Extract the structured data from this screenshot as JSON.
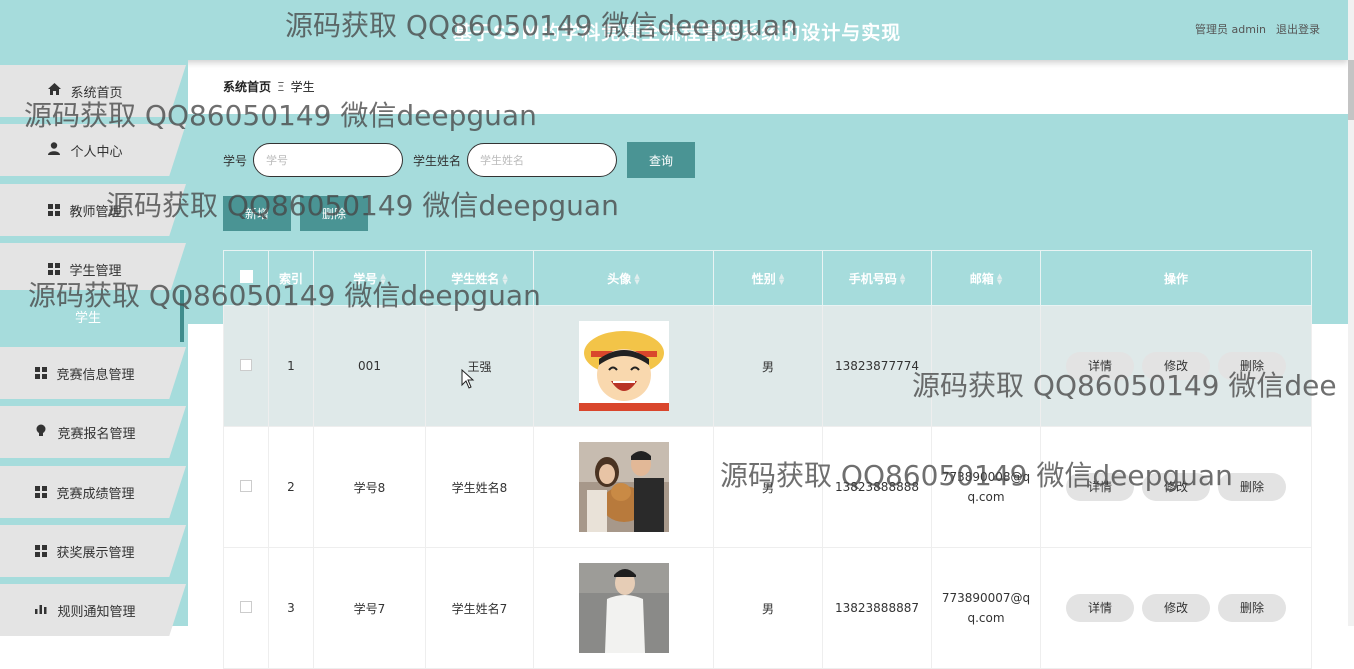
{
  "header": {
    "title": "基于SSM的学科竞赛全流程管理系统的设计与实现",
    "user": "管理员 admin",
    "logout": "退出登录"
  },
  "sidebar": {
    "items": [
      {
        "label": "系统首页",
        "icon": "home-icon"
      },
      {
        "label": "个人中心",
        "icon": "user-icon"
      },
      {
        "label": "教师管理",
        "icon": "grid-icon"
      },
      {
        "label": "学生管理",
        "icon": "grid-icon"
      },
      {
        "label": "学生",
        "icon": ""
      },
      {
        "label": "竞赛信息管理",
        "icon": "grid-icon"
      },
      {
        "label": "竞赛报名管理",
        "icon": "bulb-icon"
      },
      {
        "label": "竞赛成绩管理",
        "icon": "grid-icon"
      },
      {
        "label": "获奖展示管理",
        "icon": "grid-icon"
      },
      {
        "label": "规则通知管理",
        "icon": "bar-chart-icon"
      }
    ]
  },
  "breadcrumb": {
    "home": "系统首页",
    "sep": "Ξ",
    "current": "学生"
  },
  "search": {
    "label1": "学号",
    "placeholder1": "学号",
    "label2": "学生姓名",
    "placeholder2": "学生姓名",
    "button": "查询"
  },
  "actions": {
    "add": "新增",
    "delete": "删除"
  },
  "table": {
    "headers": [
      "索引",
      "学号",
      "学生姓名",
      "头像",
      "性别",
      "手机号码",
      "邮箱",
      "操作"
    ],
    "rows": [
      {
        "index": "1",
        "sid": "001",
        "name": "王强",
        "gender": "男",
        "phone": "13823877774",
        "email": ""
      },
      {
        "index": "2",
        "sid": "学号8",
        "name": "学生姓名8",
        "gender": "男",
        "phone": "13823888888",
        "email": "773890008@qq.com"
      },
      {
        "index": "3",
        "sid": "学号7",
        "name": "学生姓名7",
        "gender": "男",
        "phone": "13823888887",
        "email": "773890007@qq.com"
      }
    ],
    "ops": {
      "detail": "详情",
      "edit": "修改",
      "remove": "删除"
    }
  },
  "watermark": {
    "text": "源码获取 QQ86050149 微信deepguan",
    "text_partial": "源码获取 QQ86050149 微信dee"
  }
}
